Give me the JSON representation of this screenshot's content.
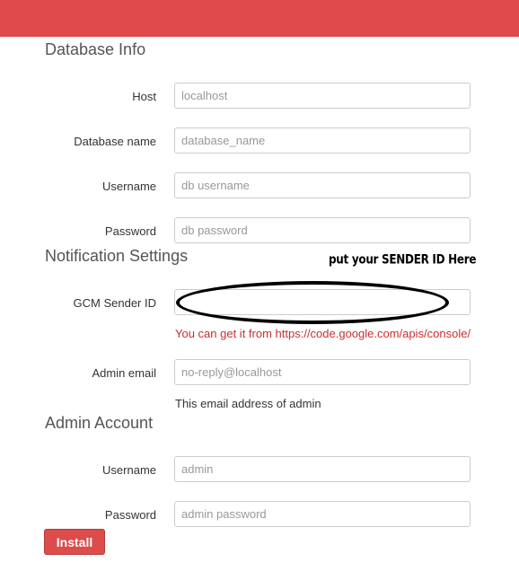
{
  "database_info": {
    "title": "Database Info",
    "host": {
      "label": "Host",
      "value": "",
      "placeholder": "localhost"
    },
    "database_name": {
      "label": "Database name",
      "value": "",
      "placeholder": "database_name"
    },
    "username": {
      "label": "Username",
      "value": "",
      "placeholder": "db username"
    },
    "password": {
      "label": "Password",
      "value": "",
      "placeholder": "db password"
    }
  },
  "notification_settings": {
    "title": "Notification Settings",
    "annotation": "put your SENDER ID Here",
    "gcm_sender_id": {
      "label": "GCM Sender ID",
      "value": "",
      "placeholder": "",
      "help_prefix": "You can get it from ",
      "help_link": "https://code.google.com/apis/console/"
    },
    "admin_email": {
      "label": "Admin email",
      "value": "",
      "placeholder": "no-reply@localhost",
      "help": "This email address of admin"
    }
  },
  "admin_account": {
    "title": "Admin Account",
    "username": {
      "label": "Username",
      "value": "",
      "placeholder": "admin"
    },
    "password": {
      "label": "Password",
      "value": "",
      "placeholder": "admin password"
    }
  },
  "install_button": {
    "label": "Install"
  },
  "colors": {
    "topbar": "#e14a4c",
    "button": "#dd4b4b",
    "help_red": "#c9302c"
  }
}
